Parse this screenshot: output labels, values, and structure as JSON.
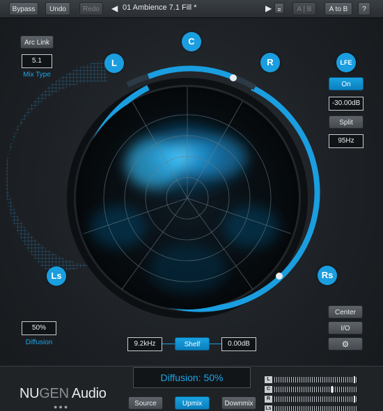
{
  "toolbar": {
    "bypass": "Bypass",
    "undo": "Undo",
    "redo": "Redo",
    "prev_icon": "◀",
    "next_icon": "▶",
    "preset_name": "01 Ambience 7.1 Fill *",
    "ab": "A | B",
    "a_to_b": "A to B",
    "help": "?"
  },
  "left_panel": {
    "arc_link": "Arc Link",
    "mix_type_value": "5.1",
    "mix_type_caption": "Mix Type",
    "diffusion_value": "50%",
    "diffusion_caption": "Diffusion"
  },
  "speakers": {
    "c": "C",
    "l": "L",
    "r": "R",
    "ls": "Ls",
    "rs": "Rs",
    "lfe": "LFE"
  },
  "lfe_panel": {
    "on": "On",
    "gain": "-30.00dB",
    "split": "Split",
    "freq": "95Hz"
  },
  "right_bottom_panel": {
    "center": "Center",
    "io": "I/O",
    "settings_icon": "gear-icon"
  },
  "eq": {
    "freq": "9.2kHz",
    "type": "Shelf",
    "gain": "0.00dB"
  },
  "bottom": {
    "brand_a": "NU",
    "brand_b": "GEN",
    "brand_c": " Audio",
    "readout": "Diffusion: 50%",
    "tabs": [
      "Source",
      "Upmix",
      "Downmix"
    ],
    "active_tab": "Upmix",
    "meter_labels": [
      "L",
      "C",
      "R",
      "Ls"
    ]
  },
  "colors": {
    "accent": "#1a9ee0",
    "caption": "#1aa6e6"
  }
}
